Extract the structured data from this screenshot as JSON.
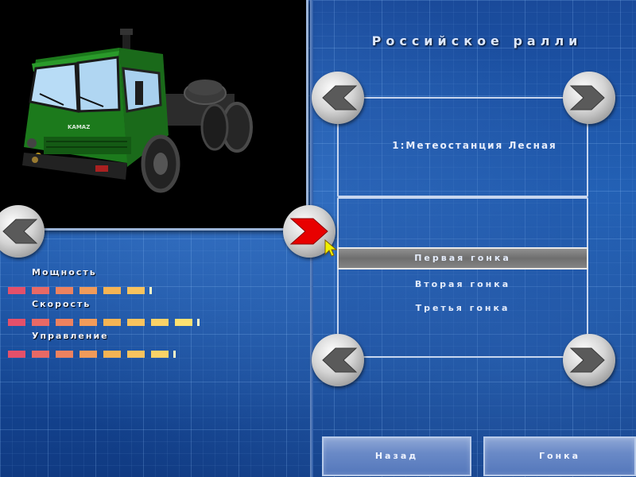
{
  "header": {
    "title": "Российское ралли"
  },
  "stage": {
    "name": "1:Метеостанция Лесная"
  },
  "races": {
    "items": [
      {
        "label": "Первая гонка"
      },
      {
        "label": "Вторая гонка"
      },
      {
        "label": "Третья гонка"
      }
    ],
    "selected_index": 0
  },
  "truck": {
    "model_badge": "KAMAZ",
    "stats": [
      {
        "label": "Мощность",
        "level": 0.74
      },
      {
        "label": "Скорость",
        "level": 0.93
      },
      {
        "label": "Управление",
        "level": 0.84
      }
    ]
  },
  "buttons": {
    "back": "Назад",
    "race": "Гонка"
  },
  "icons": {
    "prev": "chevron-left-icon",
    "next": "chevron-right-icon",
    "cursor": "mouse-cursor-icon"
  },
  "colors": {
    "stat_low": "#e4506a",
    "stat_mid": "#f5b454",
    "stat_high": "#fff07a",
    "active_arrow": "#e80000",
    "inactive_arrow": "#5a5a5a"
  }
}
